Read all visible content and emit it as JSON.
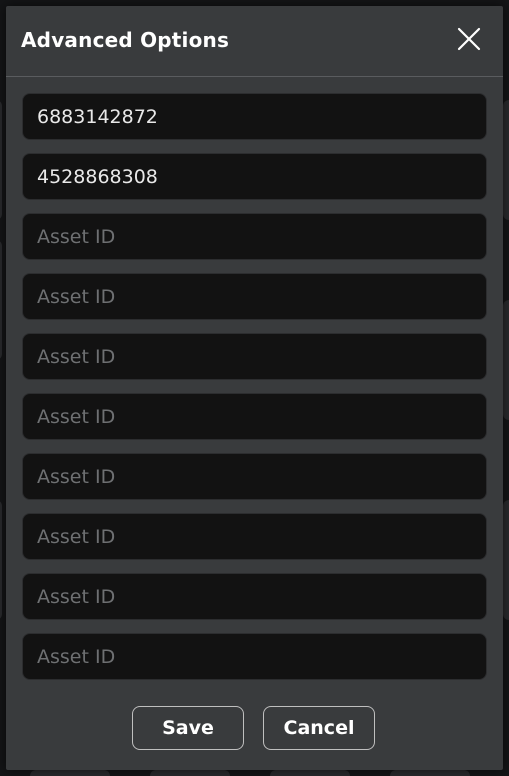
{
  "dialog": {
    "title": "Advanced Options",
    "close_icon": "close-icon"
  },
  "fields": [
    {
      "value": "6883142872",
      "placeholder": "Asset ID"
    },
    {
      "value": "4528868308",
      "placeholder": "Asset ID"
    },
    {
      "value": "",
      "placeholder": "Asset ID"
    },
    {
      "value": "",
      "placeholder": "Asset ID"
    },
    {
      "value": "",
      "placeholder": "Asset ID"
    },
    {
      "value": "",
      "placeholder": "Asset ID"
    },
    {
      "value": "",
      "placeholder": "Asset ID"
    },
    {
      "value": "",
      "placeholder": "Asset ID"
    },
    {
      "value": "",
      "placeholder": "Asset ID"
    },
    {
      "value": "",
      "placeholder": "Asset ID"
    }
  ],
  "buttons": {
    "save_label": "Save",
    "cancel_label": "Cancel"
  },
  "colors": {
    "modal_bg": "#393b3d",
    "field_bg": "#121212",
    "text": "#ffffff",
    "placeholder": "#6e7072"
  }
}
